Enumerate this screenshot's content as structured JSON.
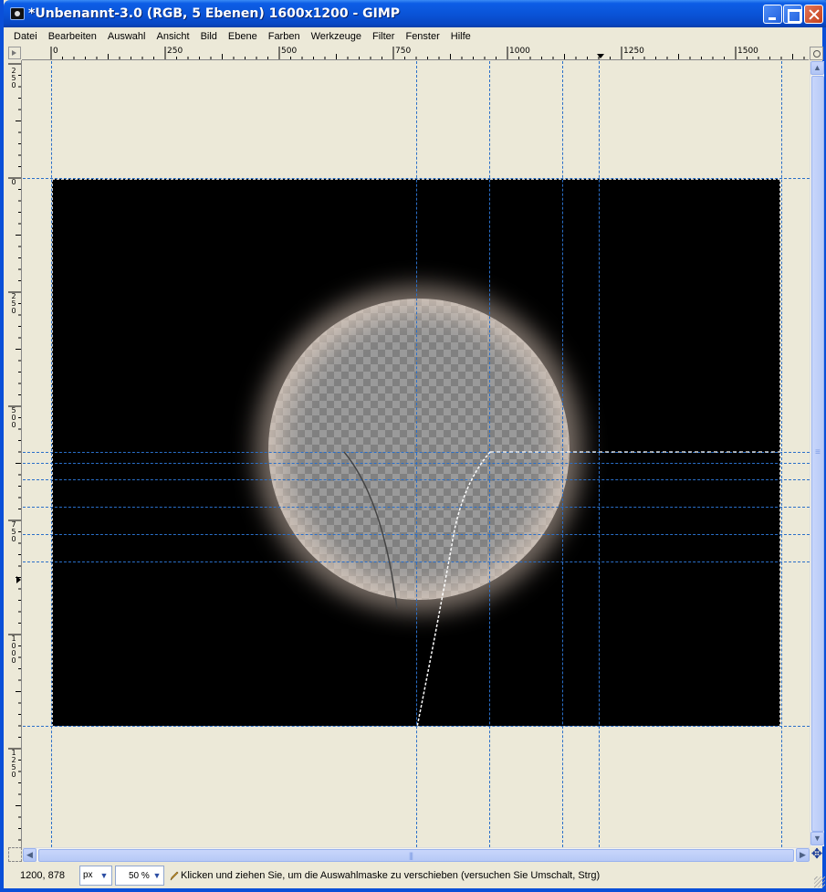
{
  "window": {
    "title": "*Unbenannt-3.0 (RGB, 5 Ebenen) 1600x1200 - GIMP"
  },
  "menubar": {
    "items": [
      {
        "label": "Datei"
      },
      {
        "label": "Bearbeiten"
      },
      {
        "label": "Auswahl"
      },
      {
        "label": "Ansicht"
      },
      {
        "label": "Bild"
      },
      {
        "label": "Ebene"
      },
      {
        "label": "Farben"
      },
      {
        "label": "Werkzeuge"
      },
      {
        "label": "Filter"
      },
      {
        "label": "Fenster"
      },
      {
        "label": "Hilfe"
      }
    ]
  },
  "rulers": {
    "horizontal_labels": [
      "0",
      "250",
      "500",
      "750",
      "1000",
      "1250",
      "1500"
    ],
    "vertical_labels": [
      "250",
      "0",
      "250",
      "500",
      "750",
      "1000",
      "1250"
    ]
  },
  "statusbar": {
    "coordinates": "1200, 878",
    "unit": "px",
    "zoom": "50 %",
    "message": "Klicken und ziehen Sie, um die Auswahlmaske zu verschieben (versuchen Sie Umschalt, Strg)"
  },
  "icons": {
    "app": "gimp-icon",
    "minimize": "minimize-icon",
    "maximize": "maximize-icon",
    "close": "close-icon",
    "navigate": "navigate-icon",
    "zoom": "magnifier-icon",
    "status": "pencil-icon"
  },
  "colors": {
    "titlebar": "#0a54d8",
    "guide": "#2a6fc9",
    "canvas_bg": "#ece9d8",
    "image_bg": "#000000"
  }
}
